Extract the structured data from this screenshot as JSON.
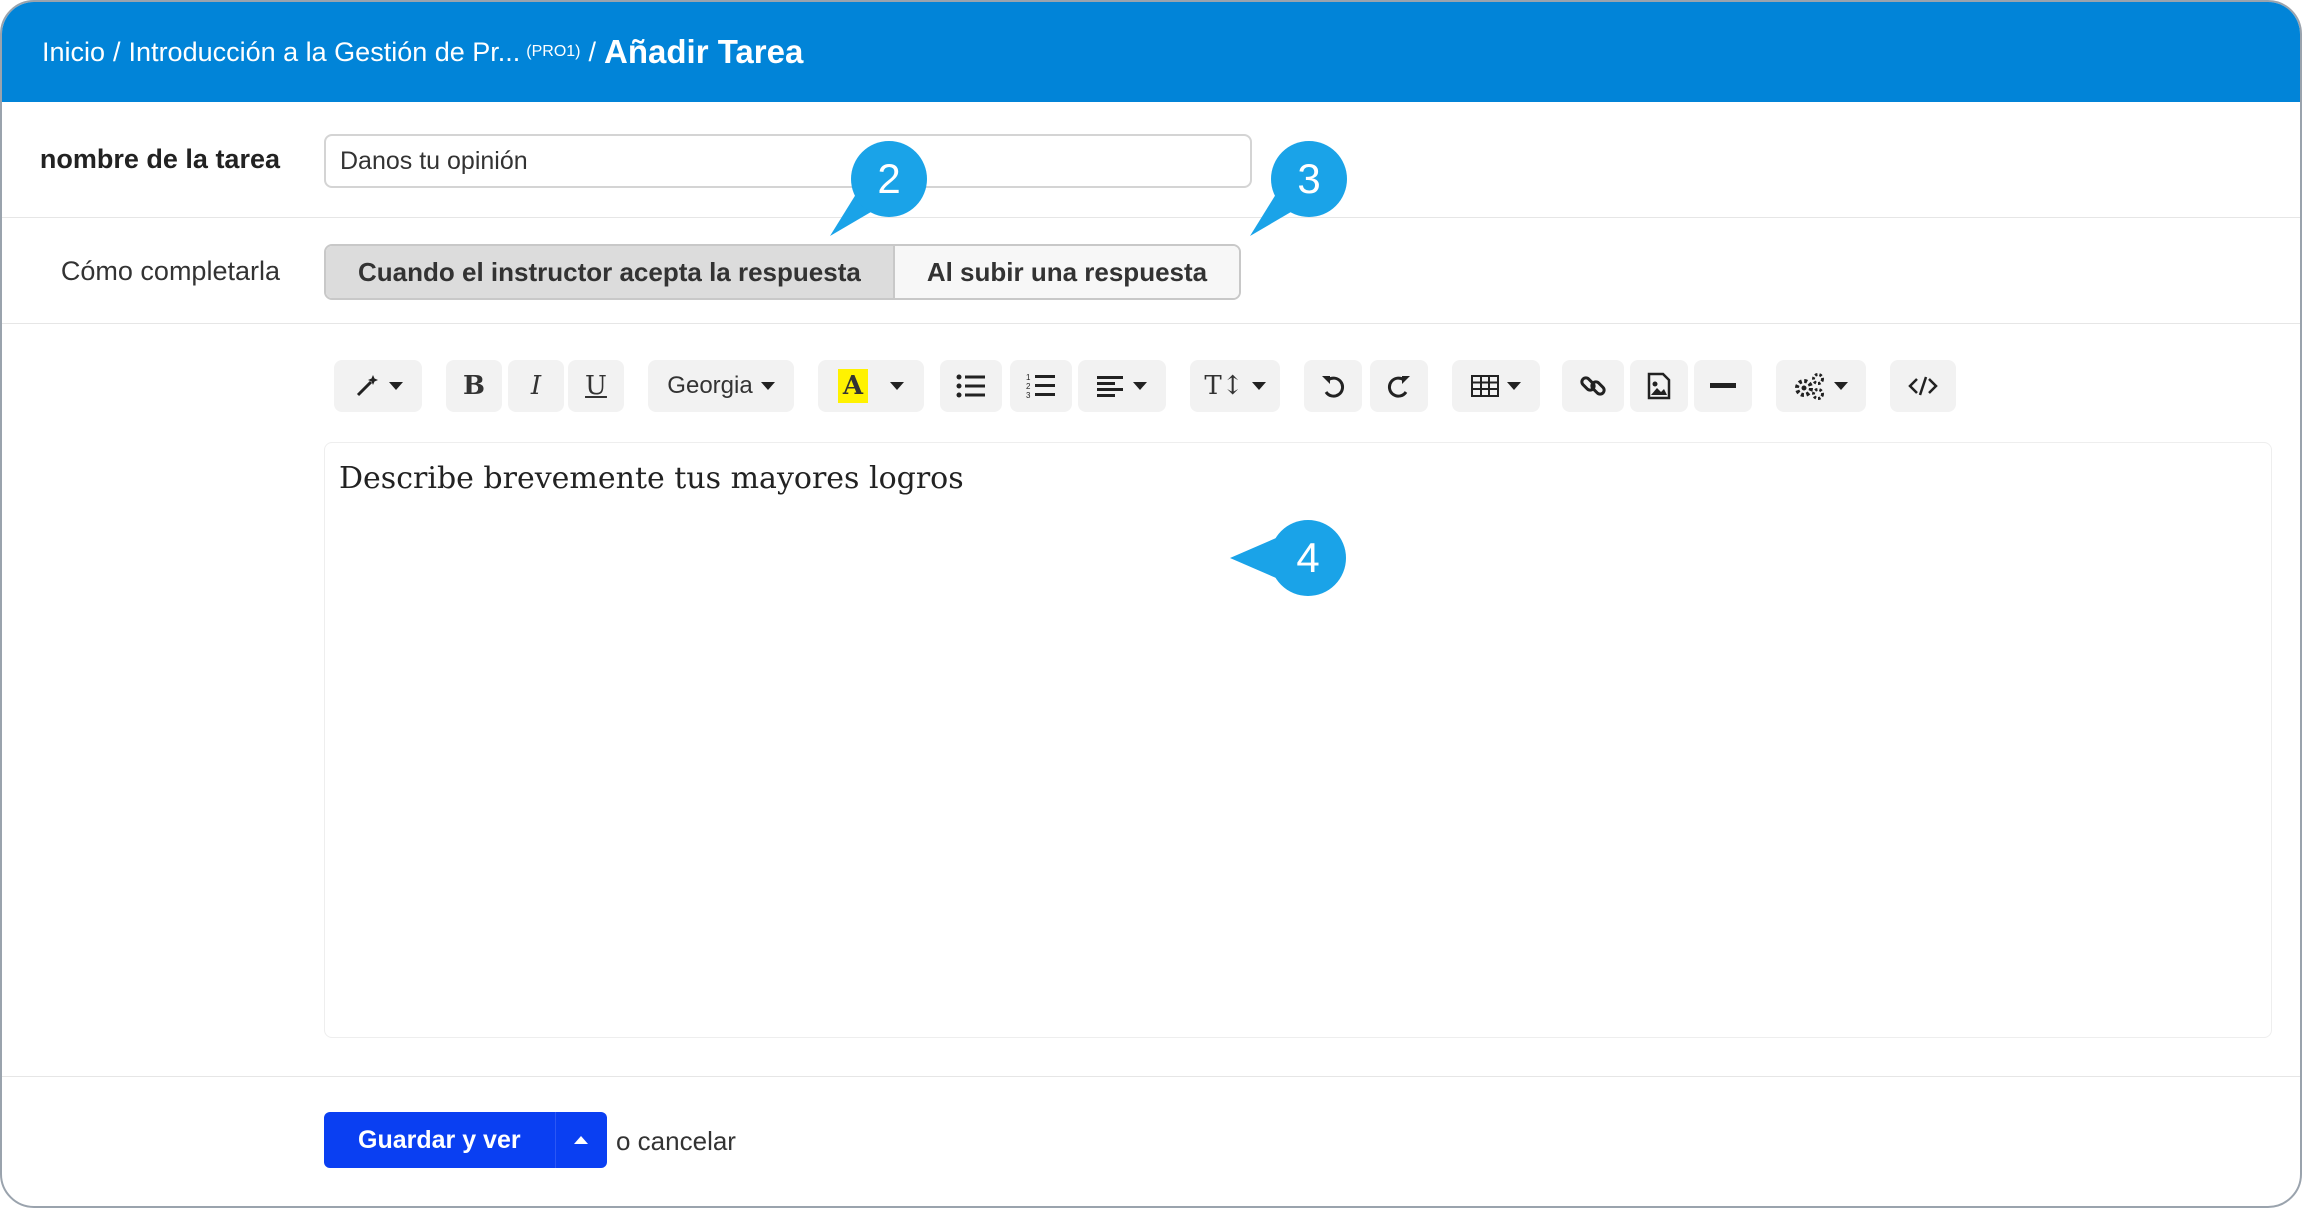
{
  "breadcrumb": {
    "home": "Inicio",
    "separator": "/",
    "course": "Introducción a la Gestión de Pr...",
    "course_code": "(PRO1)",
    "current": "Añadir Tarea"
  },
  "task_name": {
    "label": "nombre de la tarea",
    "value": "Danos tu opinión"
  },
  "completion": {
    "label": "Cómo completarla",
    "options": [
      "Cuando el instructor acepta la respuesta",
      "Al subir una respuesta"
    ],
    "selected": "Cuando el instructor acepta la respuesta"
  },
  "toolbar": {
    "font_name": "Georgia",
    "color_letter": "A",
    "highlight_color": "#fff200",
    "buttons": [
      "magic-icon",
      "bold-icon",
      "italic-icon",
      "underline-icon",
      "font-dropdown",
      "text-color-icon",
      "unordered-list-icon",
      "ordered-list-icon",
      "align-icon",
      "text-size-icon",
      "undo-icon",
      "redo-icon",
      "table-icon",
      "link-icon",
      "image-icon",
      "horizontal-rule-icon",
      "settings-icon",
      "code-view-icon"
    ]
  },
  "editor": {
    "content": "Describe brevemente tus mayores logros"
  },
  "actions": {
    "save_label": "Guardar y ver",
    "cancel_label": "o cancelar"
  },
  "callouts": [
    "2",
    "3",
    "4"
  ],
  "colors": {
    "header": "#0184d8",
    "primary_button": "#0a3ff2",
    "callout": "#1aa3e8"
  }
}
